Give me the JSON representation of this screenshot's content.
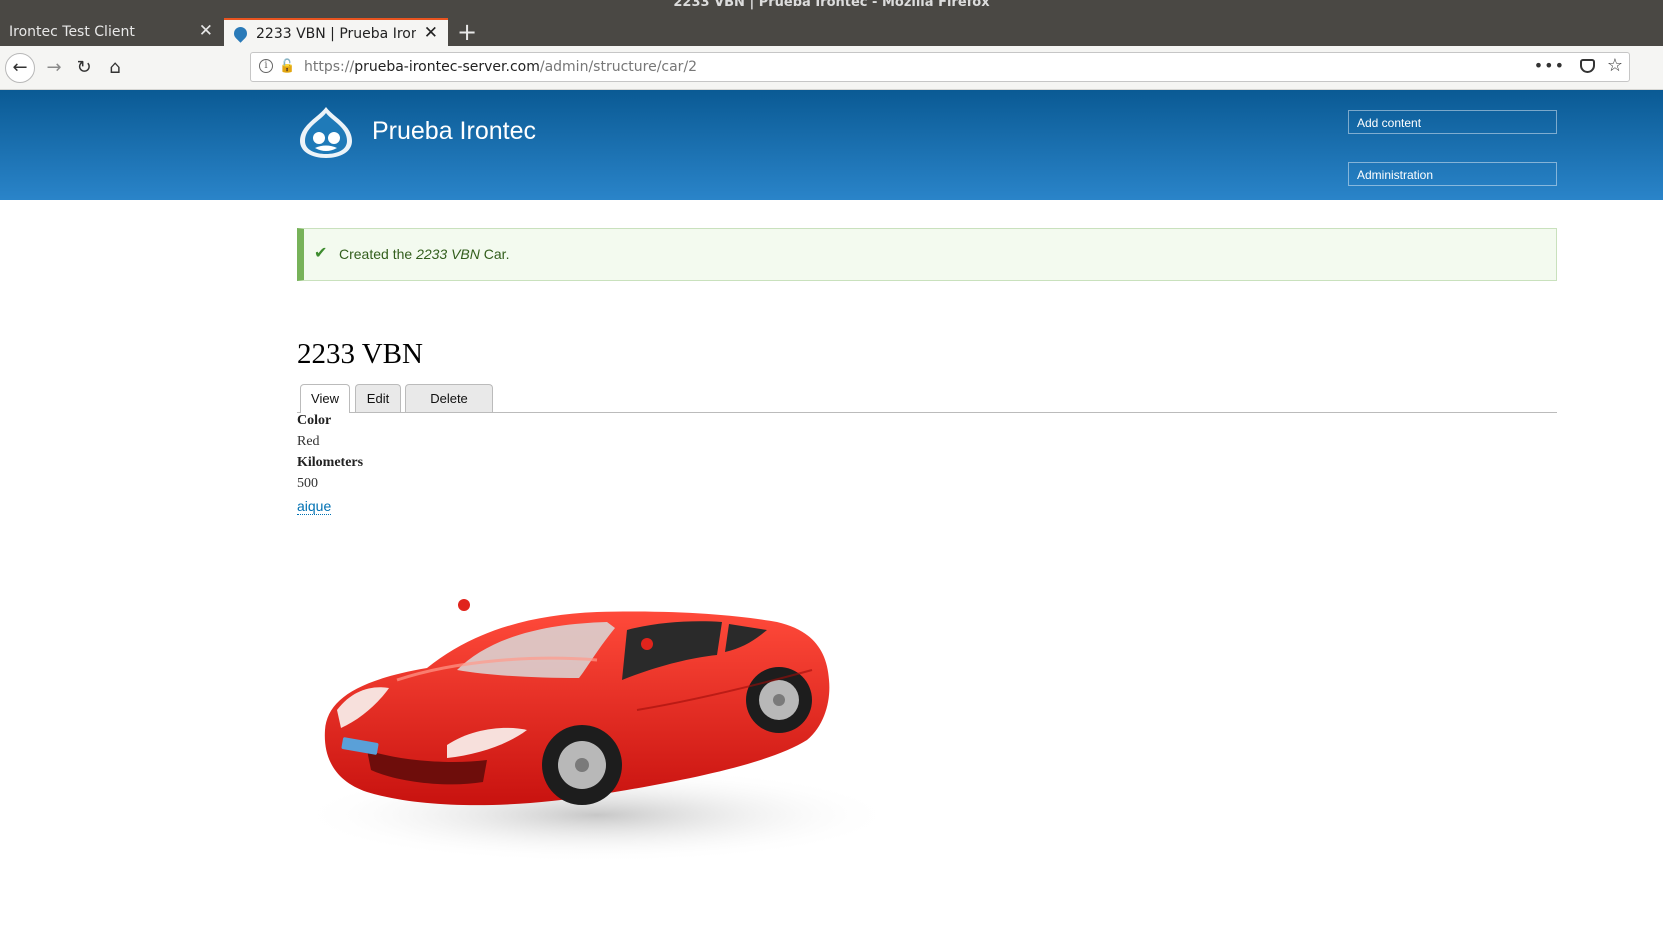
{
  "window": {
    "title": "2233 VBN | Prueba Irontec - Mozilla Firefox"
  },
  "tabs": [
    {
      "label": "Irontec Test Client",
      "active": false
    },
    {
      "label": "2233 VBN | Prueba Irontec",
      "active": true
    }
  ],
  "browser": {
    "url_scheme": "https://",
    "url_domain": "prueba-irontec-server.com",
    "url_path": "/admin/structure/car/2",
    "icons": {
      "back": "back-arrow-icon",
      "forward": "forward-arrow-icon",
      "reload": "reload-icon",
      "home": "home-icon",
      "info": "info-icon",
      "lock": "insecure-lock-icon",
      "more": "more-icon",
      "pocket": "pocket-icon",
      "bookmark": "bookmark-star-icon"
    }
  },
  "site": {
    "name": "Prueba Irontec",
    "secondary_menu": [
      "Add content",
      "Administration"
    ],
    "header_colors": [
      "#0a5a94",
      "#2a84c9"
    ]
  },
  "message": {
    "prefix": "Created the ",
    "entity": "2233 VBN",
    "suffix": " Car."
  },
  "page": {
    "title": "2233 VBN",
    "tabs": [
      "View",
      "Edit",
      "Delete"
    ]
  },
  "fields": {
    "color_label": "Color",
    "color_value": "Red",
    "km_label": "Kilometers",
    "km_value": "500",
    "owner": "aique"
  },
  "image": {
    "subject": "red sports car",
    "color": "#e8211c"
  }
}
